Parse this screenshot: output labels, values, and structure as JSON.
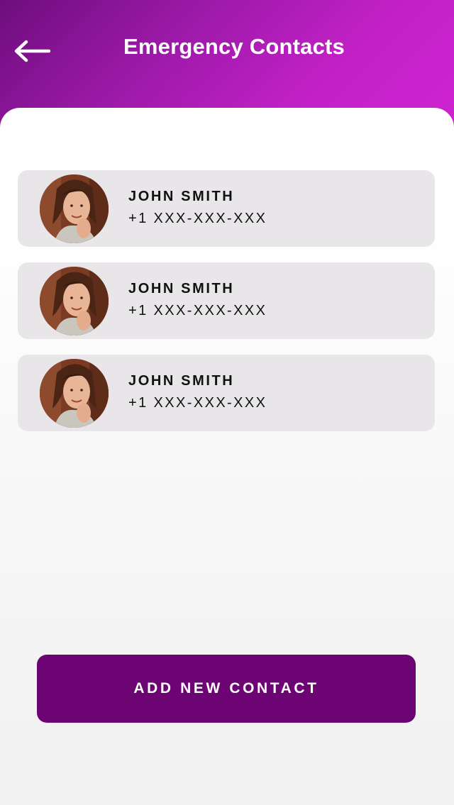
{
  "header": {
    "title": "Emergency Contacts",
    "back_icon": "arrow-left-icon"
  },
  "contacts": [
    {
      "name": "JOHN SMITH",
      "phone": "+1 XXX-XXX-XXX",
      "avatar_icon": "avatar-photo"
    },
    {
      "name": "JOHN SMITH",
      "phone": "+1 XXX-XXX-XXX",
      "avatar_icon": "avatar-photo"
    },
    {
      "name": "JOHN SMITH",
      "phone": "+1 XXX-XXX-XXX",
      "avatar_icon": "avatar-photo"
    }
  ],
  "actions": {
    "add_label": "ADD NEW CONTACT"
  },
  "colors": {
    "header_gradient_start": "#6e0d7e",
    "header_gradient_end": "#cf24d2",
    "card_background": "#e8e6e9",
    "primary_button": "#6d0474",
    "text": "#111111"
  }
}
